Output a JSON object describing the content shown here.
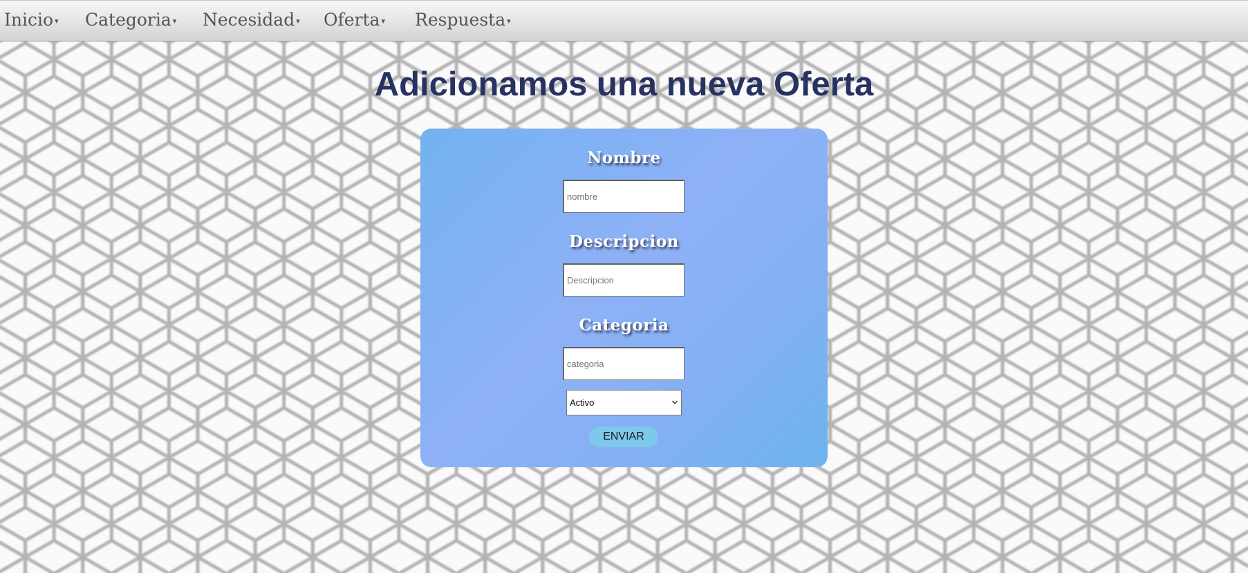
{
  "nav": {
    "items": [
      {
        "label": "Inicio"
      },
      {
        "label": "Categoria"
      },
      {
        "label": "Necesidad"
      },
      {
        "label": "Oferta"
      },
      {
        "label": "Respuesta"
      }
    ],
    "caret_glyph": "▾"
  },
  "page": {
    "title": "Adicionamos una nueva Oferta"
  },
  "form": {
    "nombre": {
      "label": "Nombre",
      "placeholder": "nombre",
      "value": ""
    },
    "descripcion": {
      "label": "Descripcion",
      "placeholder": "Descripcion",
      "value": ""
    },
    "categoria": {
      "label": "Categoria",
      "placeholder": "categoria",
      "value": ""
    },
    "estado": {
      "selected": "Activo"
    },
    "submit_label": "ENVIAR"
  },
  "colors": {
    "title": "#283262",
    "card_gradient_start": "#73b2f0",
    "card_gradient_mid": "#8eb1f6",
    "button_bg": "#7ec8ec"
  },
  "icons": {
    "nav_dropdown": "caret-down-icon",
    "select_dropdown": "chevron-down-icon"
  }
}
